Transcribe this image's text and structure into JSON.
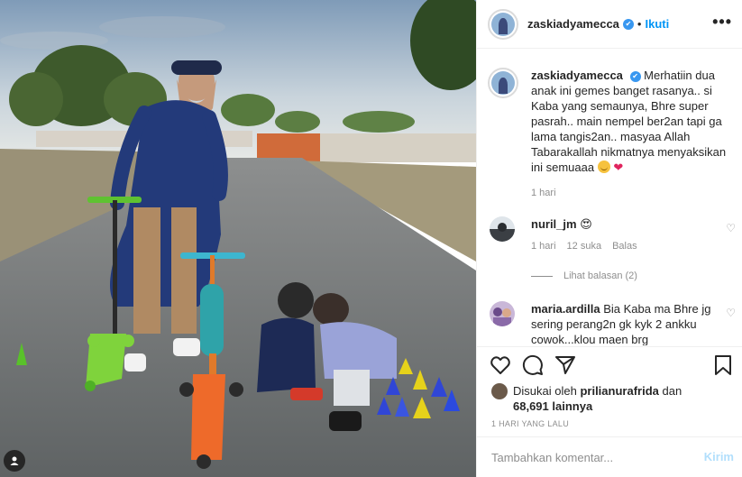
{
  "post": {
    "username": "zaskiadyamecca",
    "follow_label": "Ikuti",
    "dot": "•",
    "more_label": "•••"
  },
  "caption": {
    "username": "zaskiadyamecca",
    "text": "Merhatiin dua anak ini gemes banget rasanya.. si Kaba yang semaunya, Bhre super pasrah.. main nempel ber2an tapi ga lama tangis2an.. masyaa Allah Tabarakallah nikmatnya menyaksikan ini semuaaa",
    "time": "1 hari"
  },
  "comments": [
    {
      "username": "nuril_jm",
      "text": "😍",
      "time": "1 hari",
      "likes": "12 suka",
      "reply": "Balas",
      "view_replies": "Lihat balasan (2)"
    },
    {
      "username": "maria.ardilla",
      "text": "Bia Kaba ma Bhre jg sering perang2n gk kyk 2 ankku cowok...klou maen brg"
    }
  ],
  "likes": {
    "prefix": "Disukai oleh",
    "liker": "prilianurafrida",
    "conj": "dan",
    "count": "68,691 lainnya"
  },
  "post_date": "1 HARI YANG LALU",
  "add_comment": {
    "placeholder": "Tambahkan komentar...",
    "post_label": "Kirim"
  },
  "icons": [
    "heart-icon",
    "comment-icon",
    "share-icon",
    "bookmark-icon",
    "tag-user-icon"
  ],
  "colors": {
    "link_blue": "#0095f6",
    "verified_blue": "#3897f0",
    "muted_gray": "#8e8e8e",
    "divider": "#efefef"
  }
}
